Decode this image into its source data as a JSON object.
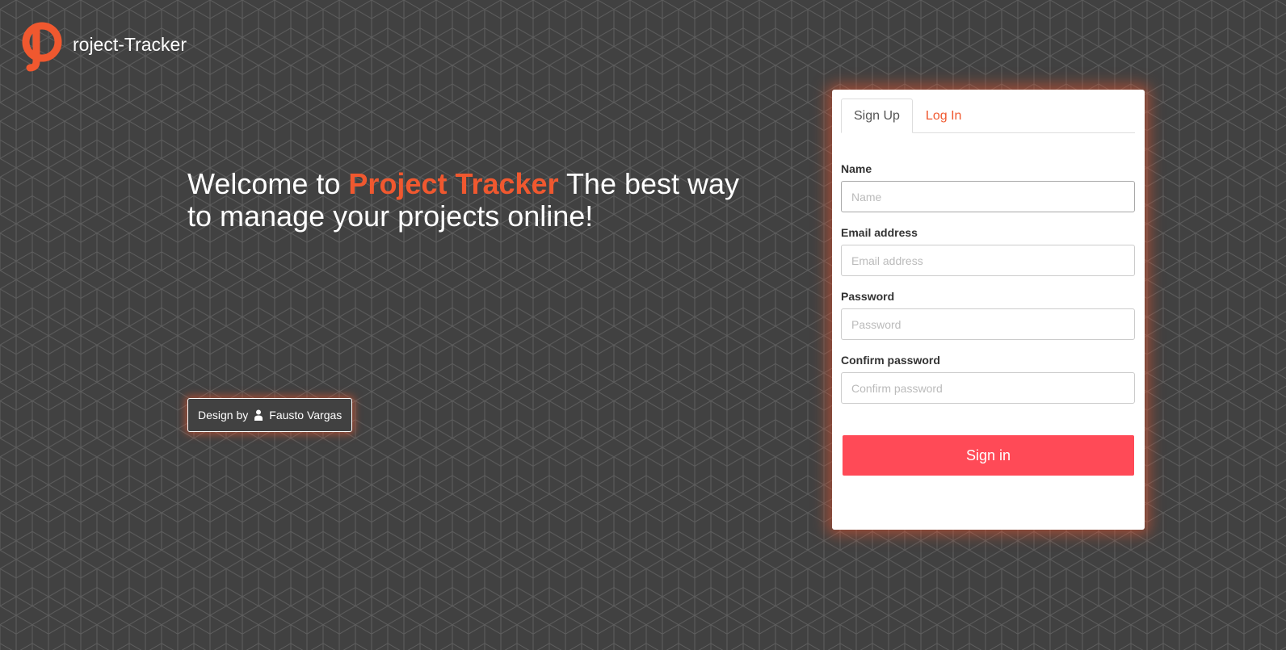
{
  "brand": {
    "logo_letter": "P",
    "name": "roject-Tracker",
    "accent_color": "#f0582f"
  },
  "hero": {
    "prefix": "Welcome to",
    "brand": "Project Tracker",
    "suffix": "The best way to manage your projects online!"
  },
  "credit": {
    "label": "Design by",
    "icon": "person-icon",
    "author": "Fausto Vargas"
  },
  "auth": {
    "tabs": [
      {
        "label": "Sign Up",
        "active": true
      },
      {
        "label": "Log In",
        "active": false
      }
    ],
    "fields": [
      {
        "label": "Name",
        "placeholder": "Name",
        "value": ""
      },
      {
        "label": "Email address",
        "placeholder": "Email address",
        "value": ""
      },
      {
        "label": "Password",
        "placeholder": "Password",
        "value": ""
      },
      {
        "label": "Confirm password",
        "placeholder": "Confirm password",
        "value": ""
      }
    ],
    "submit_label": "Sign in",
    "submit_color": "#ff4a57"
  }
}
